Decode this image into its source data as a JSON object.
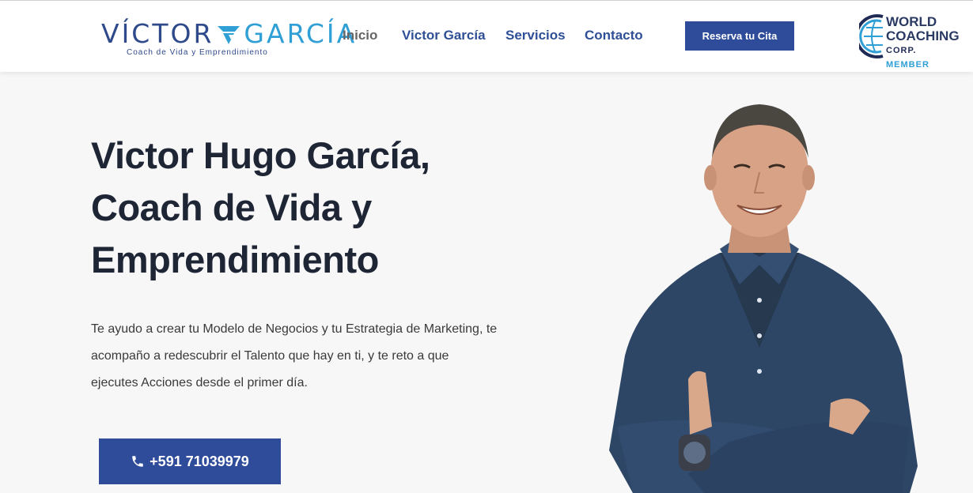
{
  "logo": {
    "name_left": "VÍCTOR",
    "name_right": "GARCÍA",
    "tagline": "Coach de Vida y Emprendimiento"
  },
  "nav": {
    "items": [
      {
        "label": "Inicio",
        "active": true
      },
      {
        "label": "Victor García",
        "active": false
      },
      {
        "label": "Servicios",
        "active": false
      },
      {
        "label": "Contacto",
        "active": false
      }
    ]
  },
  "header_cta": {
    "label": "Reserva tu Cita"
  },
  "badge": {
    "line1": "WORLD",
    "line2": "COACHING",
    "line3_a": "CORP.",
    "line3_b": "MEMBER"
  },
  "hero": {
    "title_lines": [
      "Victor Hugo García,",
      "Coach de Vida y",
      "Emprendimiento"
    ],
    "description_lines": [
      "Te ayudo a crear tu Modelo de Negocios y tu Estrategia de Marketing, te",
      "acompaño a redescubrir el Talento que hay en ti, y te reto a que",
      "ejecutes Acciones desde el primer día."
    ],
    "phone_label": "+591 71039979",
    "phone_icon": "phone-icon"
  },
  "colors": {
    "brand_blue": "#2f4c9a",
    "accent_cyan": "#2f9fd6",
    "heading": "#1e2535",
    "background": "#f7f7f7"
  }
}
